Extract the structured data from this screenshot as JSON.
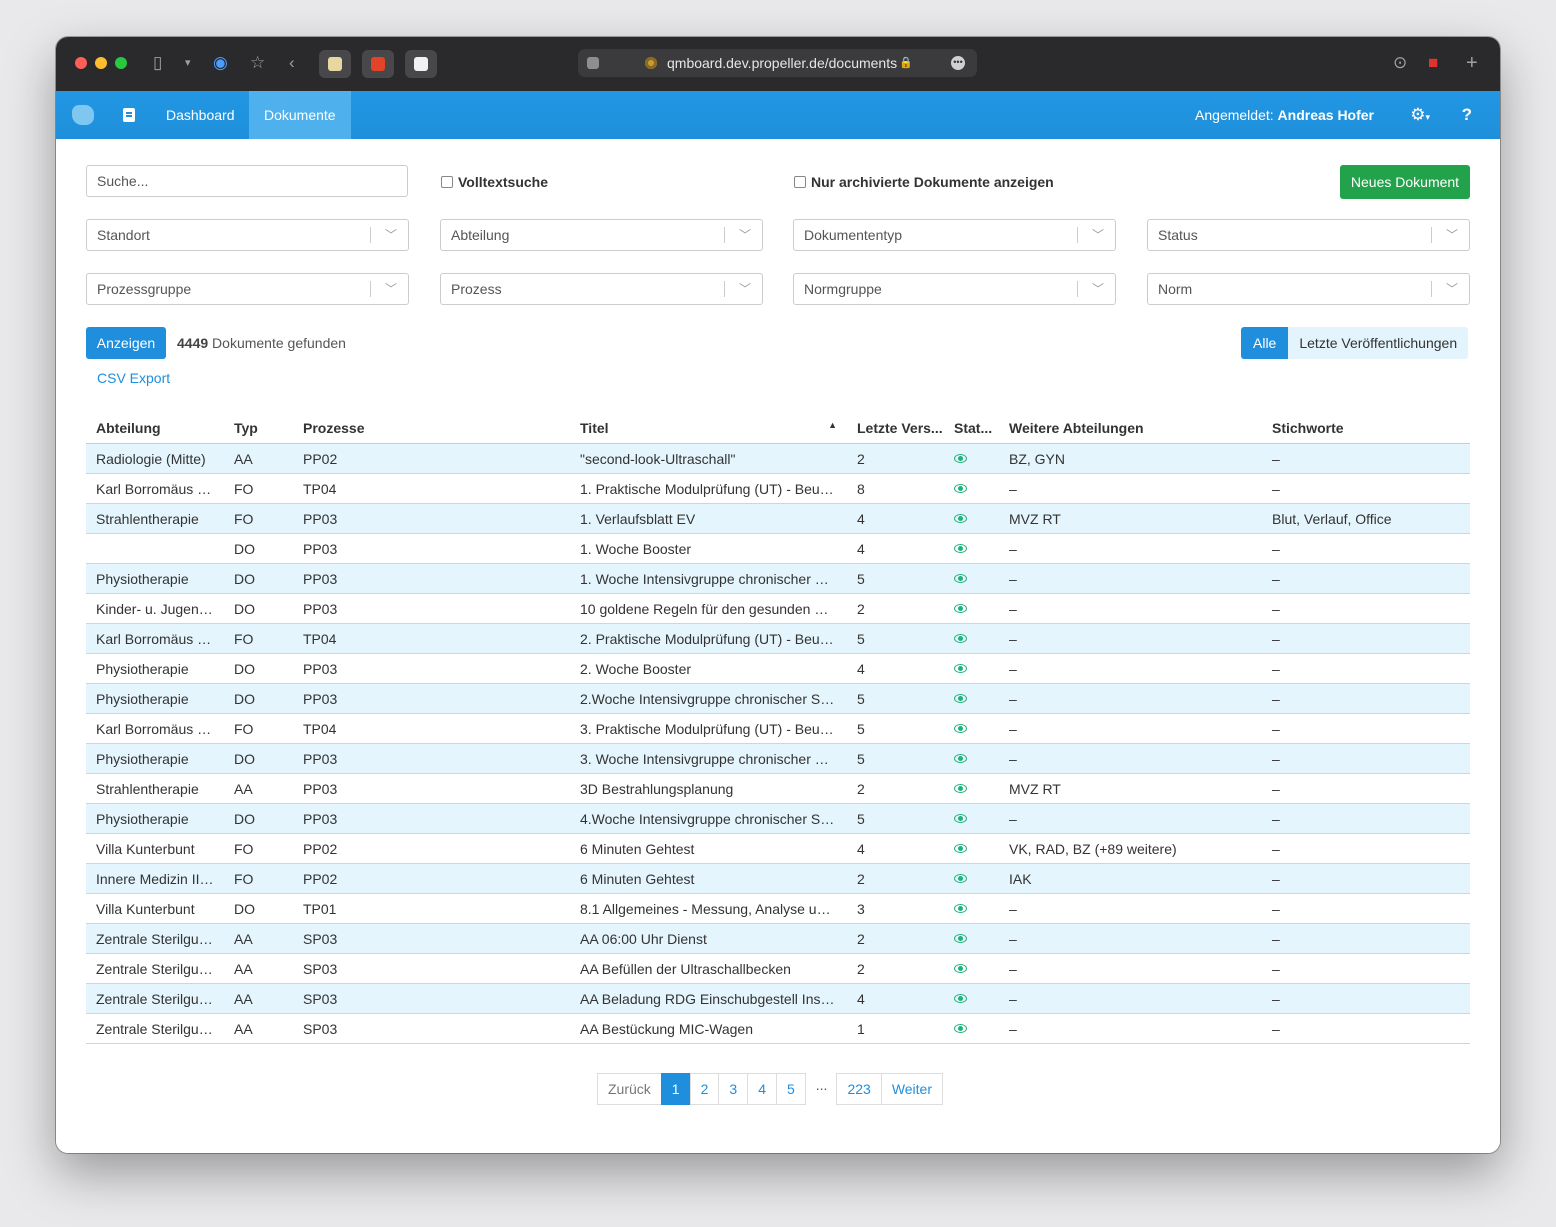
{
  "browser": {
    "url": "qmboard.dev.propeller.de/documents"
  },
  "navbar": {
    "dashboard": "Dashboard",
    "documents": "Dokumente",
    "user_prefix": "Angemeldet:",
    "user_name": "Andreas Hofer",
    "help": "?"
  },
  "filters": {
    "search_placeholder": "Suche...",
    "fulltext": "Volltextsuche",
    "archived": "Nur archivierte Dokumente anzeigen",
    "new_document": "Neues Dokument",
    "selects": [
      "Standort",
      "Abteilung",
      "Dokumententyp",
      "Status",
      "Prozessgruppe",
      "Prozess",
      "Normgruppe",
      "Norm"
    ]
  },
  "results": {
    "show_button": "Anzeigen",
    "count": "4449",
    "count_suffix": "Dokumente gefunden",
    "csv_export": "CSV Export",
    "toggle_all": "Alle",
    "toggle_recent": "Letzte Veröffentlichungen"
  },
  "table": {
    "headers": [
      "Abteilung",
      "Typ",
      "Prozesse",
      "Titel",
      "Letzte Vers...",
      "Stat...",
      "Weitere Abteilungen",
      "Stichworte"
    ],
    "rows": [
      [
        "Radiologie (Mitte)",
        "AA",
        "PP02",
        "\"second-look-Ultraschall\"",
        "2",
        "BZ, GYN",
        "–"
      ],
      [
        "Karl Borromäus Sc...",
        "FO",
        "TP04",
        "1. Praktische Modulprüfung (UT) - Beurteil...",
        "8",
        "–",
        "–"
      ],
      [
        "Strahlentherapie",
        "FO",
        "PP03",
        "1. Verlaufsblatt EV",
        "4",
        "MVZ RT",
        "Blut, Verlauf, Office"
      ],
      [
        "",
        "DO",
        "PP03",
        "1. Woche Booster",
        "4",
        "–",
        "–"
      ],
      [
        "Physiotherapie",
        "DO",
        "PP03",
        "1. Woche Intensivgruppe chronischer Schm...",
        "5",
        "–",
        "–"
      ],
      [
        "Kinder- u. Jugend...",
        "DO",
        "PP03",
        "10 goldene Regeln für den gesunden Kinder...",
        "2",
        "–",
        "–"
      ],
      [
        "Karl Borromäus Sc...",
        "FO",
        "TP04",
        "2. Praktische Modulprüfung (UT) - Beurteil...",
        "5",
        "–",
        "–"
      ],
      [
        "Physiotherapie",
        "DO",
        "PP03",
        "2. Woche Booster",
        "4",
        "–",
        "–"
      ],
      [
        "Physiotherapie",
        "DO",
        "PP03",
        "2.Woche Intensivgruppe chronischer Schm...",
        "5",
        "–",
        "–"
      ],
      [
        "Karl Borromäus Sc...",
        "FO",
        "TP04",
        "3. Praktische Modulprüfung (UT) - Beurteil...",
        "5",
        "–",
        "–"
      ],
      [
        "Physiotherapie",
        "DO",
        "PP03",
        "3. Woche Intensivgruppe chronischer Schm...",
        "5",
        "–",
        "–"
      ],
      [
        "Strahlentherapie",
        "AA",
        "PP03",
        "3D Bestrahlungsplanung",
        "2",
        "MVZ RT",
        "–"
      ],
      [
        "Physiotherapie",
        "DO",
        "PP03",
        "4.Woche Intensivgruppe chronischer Schm...",
        "5",
        "–",
        "–"
      ],
      [
        "Villa Kunterbunt",
        "FO",
        "PP02",
        "6 Minuten Gehtest",
        "4",
        "VK, RAD, BZ (+89 weitere)",
        "–"
      ],
      [
        "Innere Medizin III, ...",
        "FO",
        "PP02",
        "6 Minuten Gehtest",
        "2",
        "IAK",
        "–"
      ],
      [
        "Villa Kunterbunt",
        "DO",
        "TP01",
        "8.1 Allgemeines - Messung, Analyse und Ve...",
        "3",
        "–",
        "–"
      ],
      [
        "Zentrale Sterilgutv...",
        "AA",
        "SP03",
        "AA 06:00 Uhr Dienst",
        "2",
        "–",
        "–"
      ],
      [
        "Zentrale Sterilgutv...",
        "AA",
        "SP03",
        "AA Befüllen der Ultraschallbecken",
        "2",
        "–",
        "–"
      ],
      [
        "Zentrale Sterilgutv...",
        "AA",
        "SP03",
        "AA Beladung RDG Einschubgestell Instrum...",
        "4",
        "–",
        "–"
      ],
      [
        "Zentrale Sterilgutv...",
        "AA",
        "SP03",
        "AA Bestückung MIC-Wagen",
        "1",
        "–",
        "–"
      ]
    ]
  },
  "pagination": {
    "prev": "Zurück",
    "pages": [
      "1",
      "2",
      "3",
      "4",
      "5"
    ],
    "ellipsis": "...",
    "last": "223",
    "next": "Weiter"
  }
}
